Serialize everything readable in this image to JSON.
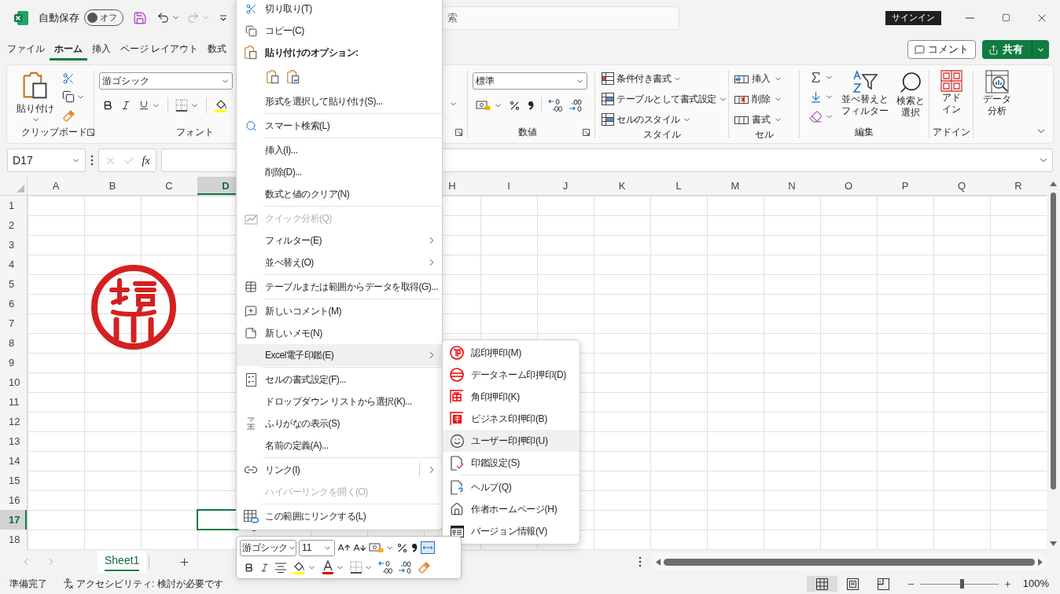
{
  "title_bar": {
    "autosave_label": "自動保存",
    "autosave": {
      "on": false,
      "label": "オフ"
    },
    "redo": {
      "disabled": true
    },
    "search": {
      "placeholder": "索"
    },
    "sign_in": "サインイン"
  },
  "ribbon_tabs": [
    {
      "label": "ファイル",
      "selected": false
    },
    {
      "label": "ホーム",
      "selected": true
    },
    {
      "label": "挿入",
      "selected": false
    },
    {
      "label": "ページ レイアウト",
      "selected": false
    },
    {
      "label": "数式",
      "selected": false
    }
  ],
  "header_buttons": {
    "comment": "コメント",
    "share": "共有"
  },
  "ribbon": {
    "clipboard": {
      "paste": "貼り付け",
      "label": "クリップボード"
    },
    "font": {
      "font_name": "游ゴシック",
      "label": "フォント"
    },
    "number": {
      "format": "標準",
      "label": "数値"
    },
    "styles": {
      "buttons": [
        "条件付き書式",
        "テーブルとして書式設定",
        "セルのスタイル"
      ],
      "label": "スタイル"
    },
    "cells": {
      "buttons": [
        "挿入",
        "削除",
        "書式"
      ],
      "label": "セル"
    },
    "editing": {
      "sort": [
        "並べ替えと",
        "フィルター"
      ],
      "find": [
        "検索と",
        "選択"
      ],
      "label": "編集"
    },
    "addins": {
      "button": [
        "アド",
        "イン"
      ],
      "label": "アドイン"
    },
    "analysis": {
      "button": [
        "データ",
        "分析"
      ]
    }
  },
  "formula_bar": {
    "name_box": "D17",
    "function_label": "fx"
  },
  "sheet": {
    "columns_left": [
      {
        "label": "A",
        "selected": false
      },
      {
        "label": "B",
        "selected": false
      },
      {
        "label": "C",
        "selected": false
      },
      {
        "label": "D",
        "selected": true
      }
    ],
    "columns_right": [
      {
        "label": "H",
        "selected": false
      },
      {
        "label": "I",
        "selected": false
      },
      {
        "label": "J",
        "selected": false
      },
      {
        "label": "K",
        "selected": false
      },
      {
        "label": "L",
        "selected": false
      },
      {
        "label": "M",
        "selected": false
      },
      {
        "label": "N",
        "selected": false
      },
      {
        "label": "O",
        "selected": false
      },
      {
        "label": "P",
        "selected": false
      },
      {
        "label": "Q",
        "selected": false
      },
      {
        "label": "R",
        "selected": false
      }
    ],
    "rows": [
      {
        "label": "1",
        "selected": false
      },
      {
        "label": "2",
        "selected": false
      },
      {
        "label": "3",
        "selected": false
      },
      {
        "label": "4",
        "selected": false
      },
      {
        "label": "5",
        "selected": false
      },
      {
        "label": "6",
        "selected": false
      },
      {
        "label": "7",
        "selected": false
      },
      {
        "label": "8",
        "selected": false
      },
      {
        "label": "9",
        "selected": false
      },
      {
        "label": "10",
        "selected": false
      },
      {
        "label": "11",
        "selected": false
      },
      {
        "label": "12",
        "selected": false
      },
      {
        "label": "13",
        "selected": false
      },
      {
        "label": "14",
        "selected": false
      },
      {
        "label": "15",
        "selected": false
      },
      {
        "label": "16",
        "selected": false
      },
      {
        "label": "17",
        "selected": true
      },
      {
        "label": "18",
        "selected": false
      }
    ]
  },
  "sheet_tabs": [
    {
      "label": "Sheet1",
      "selected": true
    }
  ],
  "status_bar": {
    "ready": "準備完了",
    "accessibility": "アクセシビリティ: 検討が必要です",
    "views": [
      {
        "kind": "normal",
        "selected": true
      },
      {
        "kind": "page-layout",
        "selected": false
      },
      {
        "kind": "page-break",
        "selected": false
      }
    ],
    "zoom": {
      "level": 0.53,
      "reading": "100%"
    }
  },
  "context_menu": {
    "items": [
      {
        "kind": "item",
        "label": "切り取り(T)",
        "disabled": false,
        "submenu": false,
        "selected": false
      },
      {
        "kind": "item",
        "label": "コピー(C)",
        "disabled": false,
        "submenu": false,
        "selected": false
      },
      {
        "kind": "header",
        "label": "貼り付けのオプション:"
      },
      {
        "kind": "paste-options"
      },
      {
        "kind": "item",
        "label": "形式を選択して貼り付け(S)...",
        "disabled": false,
        "submenu": false,
        "selected": false
      },
      {
        "kind": "separator"
      },
      {
        "kind": "item",
        "label": "スマート検索(L)",
        "disabled": false,
        "submenu": false,
        "selected": false
      },
      {
        "kind": "separator"
      },
      {
        "kind": "item",
        "label": "挿入(I)...",
        "disabled": false,
        "submenu": false,
        "selected": false
      },
      {
        "kind": "item",
        "label": "削除(D)...",
        "disabled": false,
        "submenu": false,
        "selected": false
      },
      {
        "kind": "item",
        "label": "数式と値のクリア(N)",
        "disabled": false,
        "submenu": false,
        "selected": false
      },
      {
        "kind": "separator"
      },
      {
        "kind": "item",
        "label": "クイック分析(Q)",
        "disabled": true,
        "submenu": false,
        "selected": false
      },
      {
        "kind": "item",
        "label": "フィルター(E)",
        "disabled": false,
        "submenu": true,
        "selected": false
      },
      {
        "kind": "item",
        "label": "並べ替え(O)",
        "disabled": false,
        "submenu": true,
        "selected": false
      },
      {
        "kind": "separator"
      },
      {
        "kind": "item",
        "label": "テーブルまたは範囲からデータを取得(G)...",
        "disabled": false,
        "submenu": false,
        "selected": false
      },
      {
        "kind": "separator"
      },
      {
        "kind": "item",
        "label": "新しいコメント(M)",
        "disabled": false,
        "submenu": false,
        "selected": false
      },
      {
        "kind": "item",
        "label": "新しいメモ(N)",
        "disabled": false,
        "submenu": false,
        "selected": false
      },
      {
        "kind": "item",
        "label": "Excel電子印鑑(E)",
        "disabled": false,
        "submenu": true,
        "selected": true
      },
      {
        "kind": "separator"
      },
      {
        "kind": "item",
        "label": "セルの書式設定(F)...",
        "disabled": false,
        "submenu": false,
        "selected": false
      },
      {
        "kind": "item",
        "label": "ドロップダウン リストから選択(K)...",
        "disabled": false,
        "submenu": false,
        "selected": false
      },
      {
        "kind": "item",
        "label": "ふりがなの表示(S)",
        "disabled": false,
        "submenu": false,
        "selected": false
      },
      {
        "kind": "item",
        "label": "名前の定義(A)...",
        "disabled": false,
        "submenu": false,
        "selected": false
      },
      {
        "kind": "separator"
      },
      {
        "kind": "split-item",
        "label": "リンク(I)",
        "disabled": false,
        "submenu": true,
        "selected": false
      },
      {
        "kind": "item",
        "label": "ハイパーリンクを開く(O)",
        "disabled": true,
        "submenu": false,
        "selected": false
      },
      {
        "kind": "separator"
      },
      {
        "kind": "item",
        "label": "この範囲にリンクする(L)",
        "disabled": false,
        "submenu": false,
        "selected": false
      }
    ]
  },
  "submenu": {
    "items": [
      {
        "kind": "item",
        "label": "認印押印(M)",
        "selected": false
      },
      {
        "kind": "item",
        "label": "データネーム印押印(D)",
        "selected": false
      },
      {
        "kind": "item",
        "label": "角印押印(K)",
        "selected": false
      },
      {
        "kind": "item",
        "label": "ビジネス印押印(B)",
        "selected": false
      },
      {
        "kind": "item",
        "label": "ユーザー印押印(U)",
        "selected": true
      },
      {
        "kind": "item",
        "label": "印鑑設定(S)",
        "selected": false
      },
      {
        "kind": "separator"
      },
      {
        "kind": "item",
        "label": "ヘルプ(Q)",
        "selected": false
      },
      {
        "kind": "item",
        "label": "作者ホームページ(H)",
        "selected": false
      },
      {
        "kind": "item",
        "label": "バージョン情報(V)",
        "selected": false
      }
    ]
  },
  "mini_toolbar": {
    "font": "游ゴシック",
    "size": "11"
  }
}
